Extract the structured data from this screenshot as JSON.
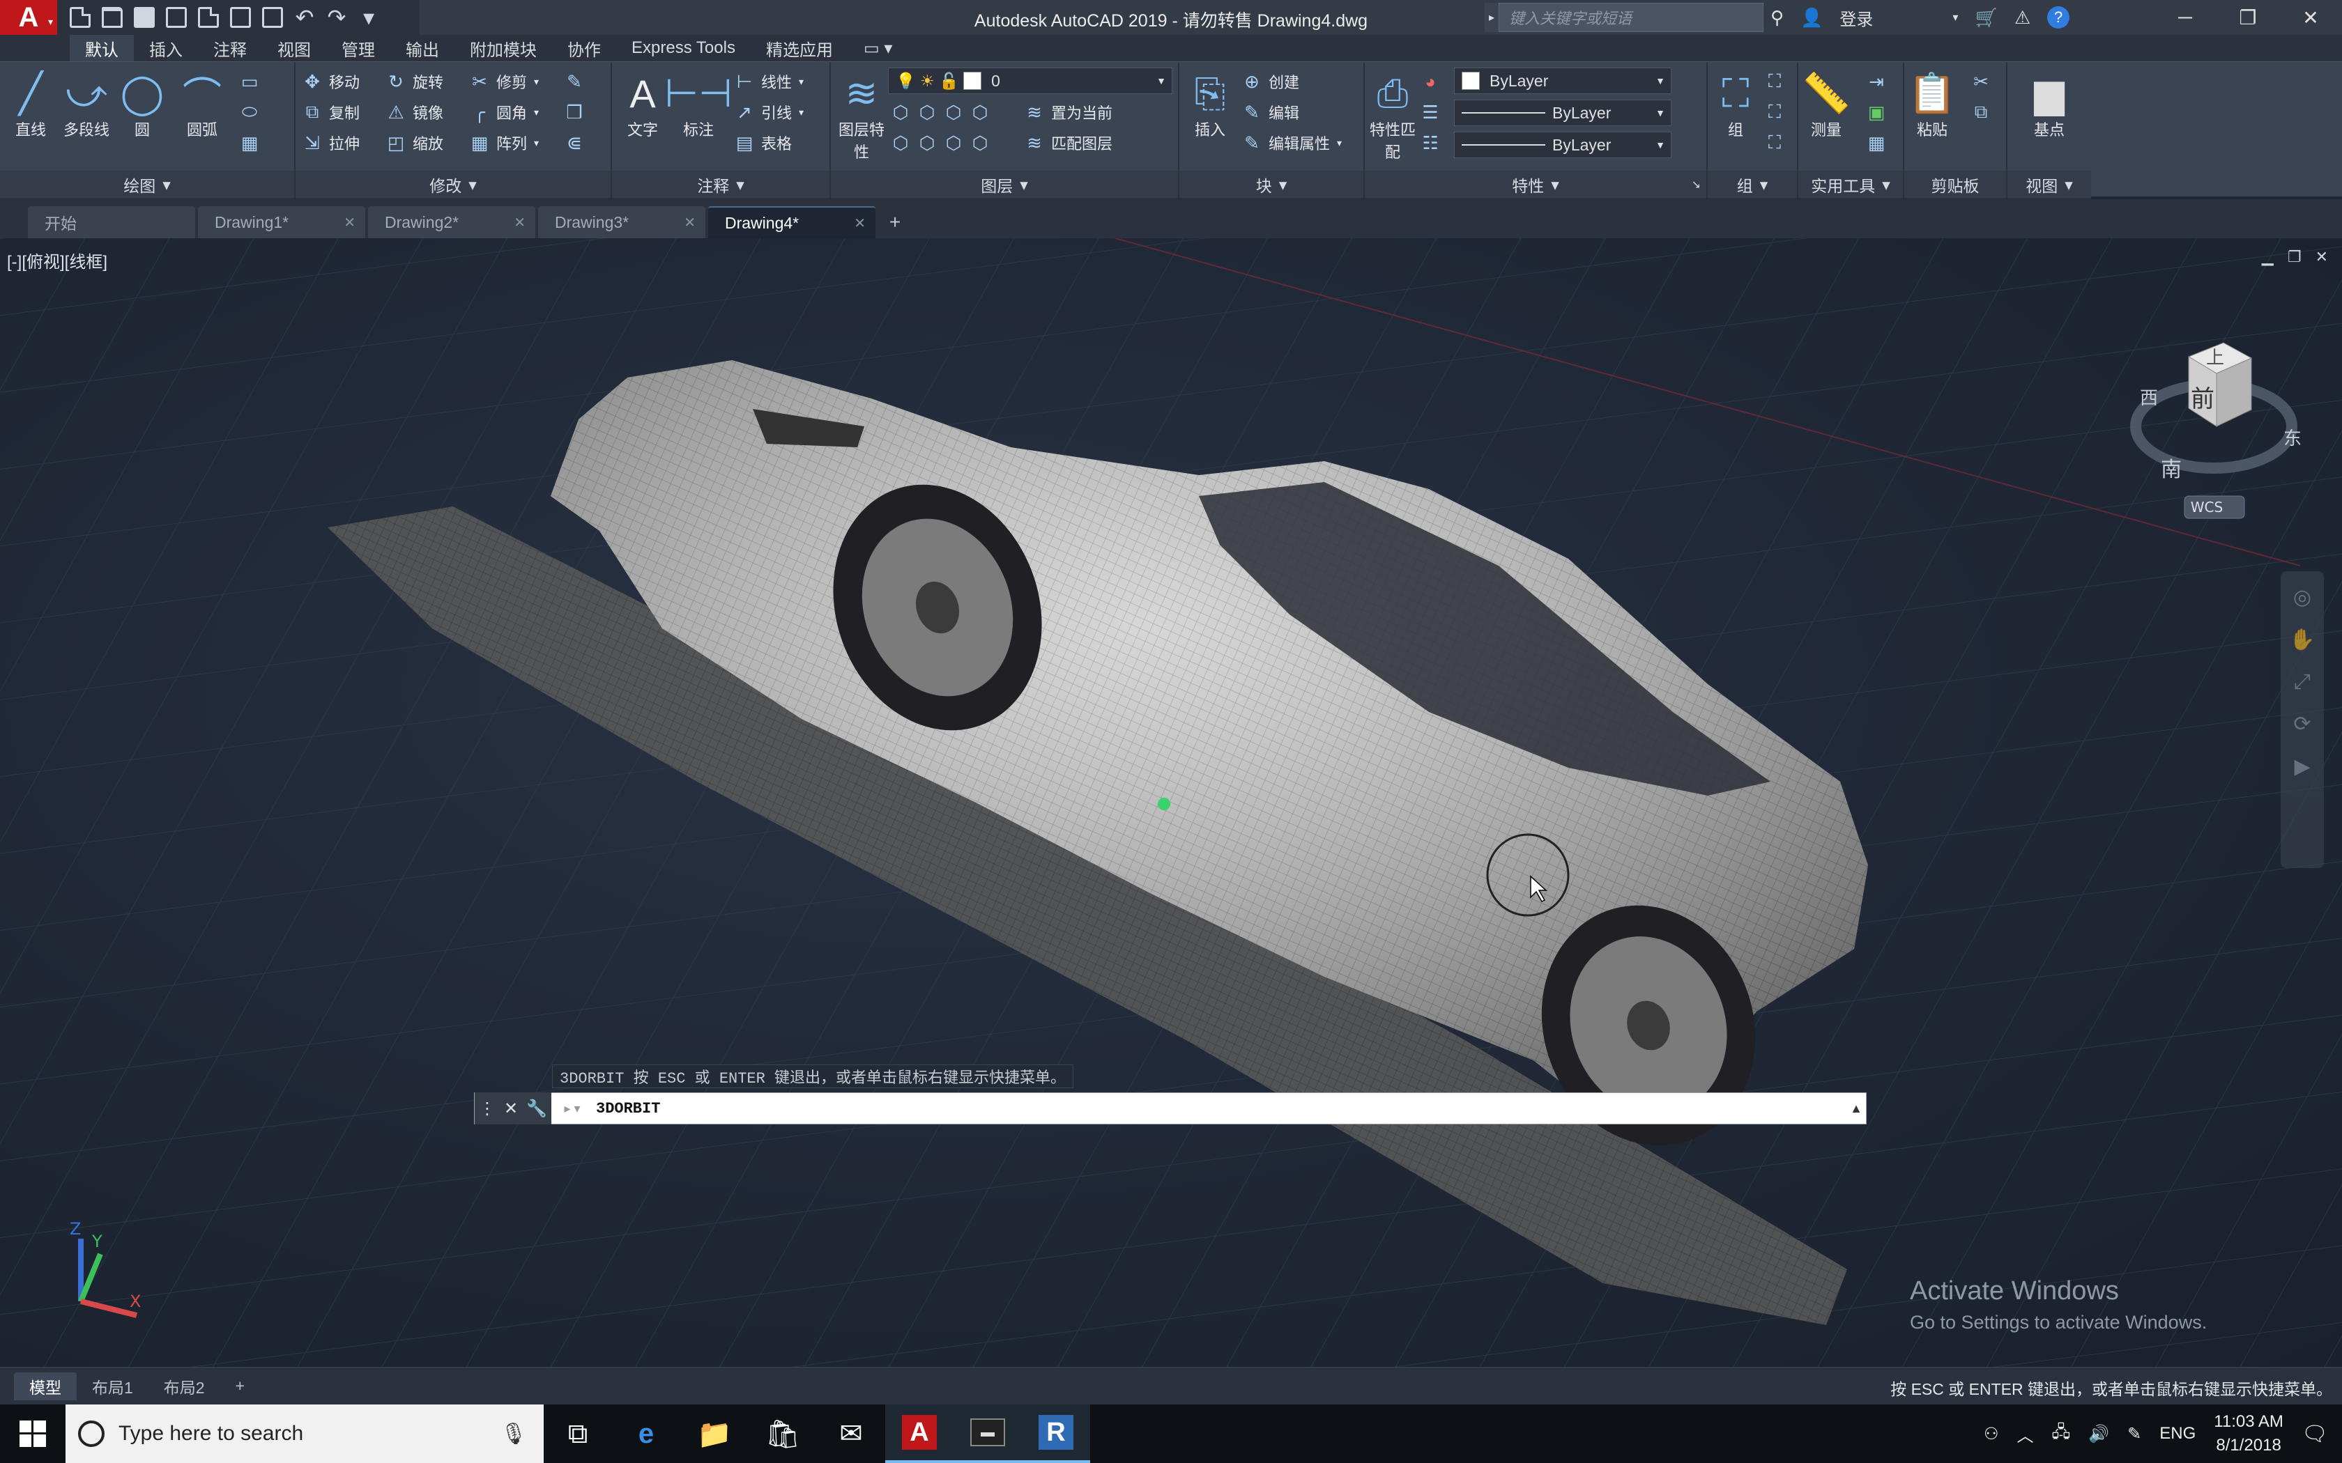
{
  "app_title": "Autodesk AutoCAD 2019 - 请勿转售    Drawing4.dwg",
  "search_placeholder": "键入关键字或短语",
  "login_label": "登录",
  "ribbon_tabs": [
    "默认",
    "插入",
    "注释",
    "视图",
    "管理",
    "输出",
    "附加模块",
    "协作",
    "Express Tools",
    "精选应用"
  ],
  "ribbon": {
    "draw": {
      "label": "绘图",
      "line": "直线",
      "polyline": "多段线",
      "circle": "圆",
      "arc": "圆弧"
    },
    "modify": {
      "label": "修改",
      "move": "移动",
      "rotate": "旋转",
      "trim": "修剪",
      "copy": "复制",
      "mirror": "镜像",
      "fillet": "圆角",
      "stretch": "拉伸",
      "scale": "缩放",
      "array": "阵列"
    },
    "annotation": {
      "label": "注释",
      "text": "文字",
      "dimension": "标注",
      "linear": "线性",
      "leader": "引线",
      "table": "表格"
    },
    "layers": {
      "label": "图层",
      "layer_props": "图层特性",
      "current_layer": "0",
      "set_current": "置为当前",
      "match_layer": "匹配图层"
    },
    "block": {
      "label": "块",
      "insert": "插入",
      "create": "创建",
      "edit": "编辑",
      "edit_attr": "编辑属性"
    },
    "properties": {
      "label": "特性",
      "match": "特性匹配",
      "color": "ByLayer",
      "linetype": "ByLayer",
      "lineweight": "ByLayer"
    },
    "groups": {
      "label": "组",
      "group": "组"
    },
    "utilities": {
      "label": "实用工具",
      "measure": "测量"
    },
    "clipboard": {
      "label": "剪贴板",
      "paste": "粘贴"
    },
    "view": {
      "label": "视图",
      "base": "基点"
    }
  },
  "doc_tabs": [
    {
      "label": "开始",
      "active": false
    },
    {
      "label": "Drawing1*",
      "active": false
    },
    {
      "label": "Drawing2*",
      "active": false
    },
    {
      "label": "Drawing3*",
      "active": false
    },
    {
      "label": "Drawing4*",
      "active": true
    }
  ],
  "viewport_label": "[-][俯视][线框]",
  "viewcube": {
    "top": "上",
    "front": "前",
    "west": "西",
    "east": "东",
    "south": "南",
    "wcs": "WCS"
  },
  "ucs": {
    "x": "X",
    "y": "Y",
    "z": "Z"
  },
  "watermark": {
    "line1": "Activate Windows",
    "line2": "Go to Settings to activate Windows."
  },
  "command": {
    "history": "3DORBIT 按 ESC 或 ENTER 键退出，或者单击鼠标右键显示快捷菜单。",
    "input": "3DORBIT"
  },
  "layout_tabs": [
    "模型",
    "布局1",
    "布局2"
  ],
  "status_message": "按 ESC 或 ENTER 键退出，或者单击鼠标右键显示快捷菜单。",
  "taskbar": {
    "search_placeholder": "Type here to search",
    "language": "ENG",
    "time": "11:03 AM",
    "date": "8/1/2018"
  },
  "colors": {
    "accent": "#c0171a",
    "ribbon_bg": "#3b4453",
    "viewport_bg": "#1e2633"
  }
}
